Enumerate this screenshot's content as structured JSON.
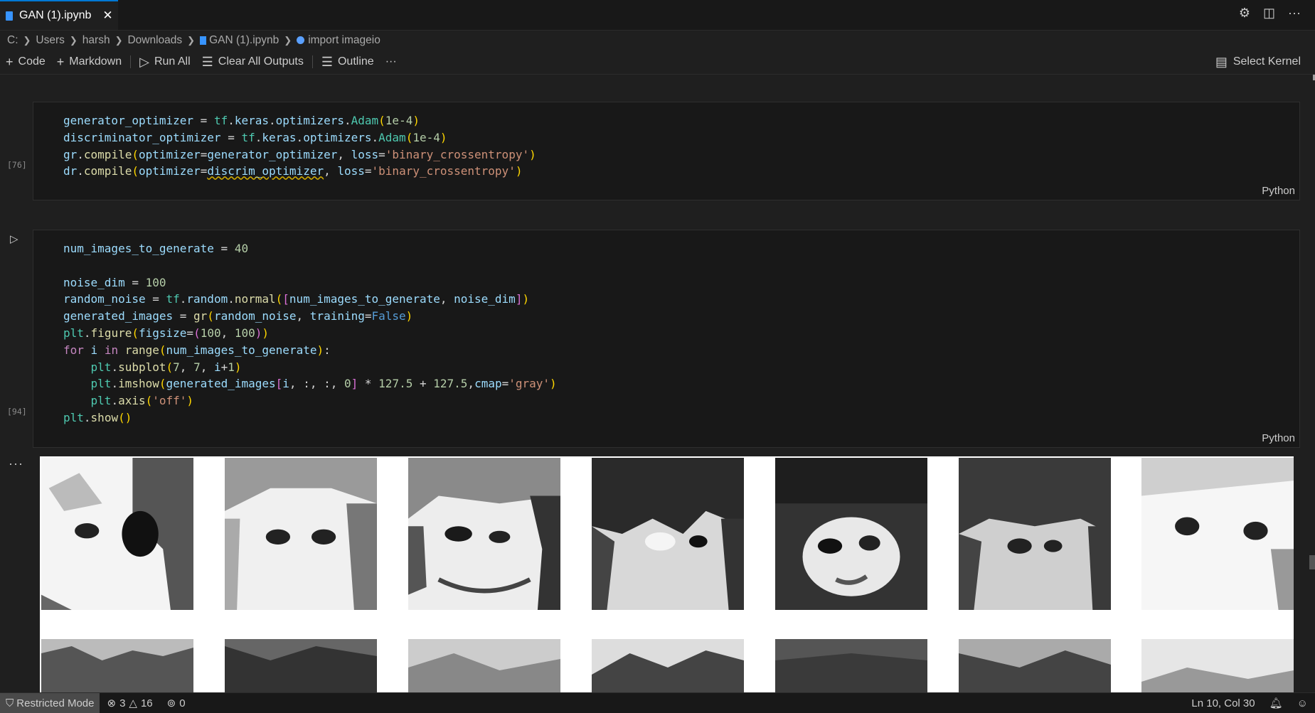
{
  "tab": {
    "title": "GAN (1).ipynb",
    "close": "✕"
  },
  "header_actions": {
    "settings": "⚙",
    "split": "◫",
    "more": "···"
  },
  "breadcrumb": [
    "C:",
    "Users",
    "harsh",
    "Downloads",
    "GAN (1).ipynb",
    "import imageio"
  ],
  "toolbar": {
    "code_label": "Code",
    "markdown_label": "Markdown",
    "run_all_label": "Run All",
    "clear_outputs_label": "Clear All Outputs",
    "outline_label": "Outline",
    "more_label": "···",
    "select_kernel_label": "Select Kernel"
  },
  "cells": [
    {
      "exec_count": "[76]",
      "language": "Python"
    },
    {
      "exec_count": "[94]",
      "language": "Python"
    }
  ],
  "output_menu": "···",
  "status": {
    "restricted_mode": "Restricted Mode",
    "errors": "3",
    "warnings": "16",
    "ports": "0",
    "position": "Ln 10, Col 30"
  },
  "colors": {
    "accent": "#0078d4",
    "background": "#1f1f1f",
    "cell_background": "#181818"
  }
}
